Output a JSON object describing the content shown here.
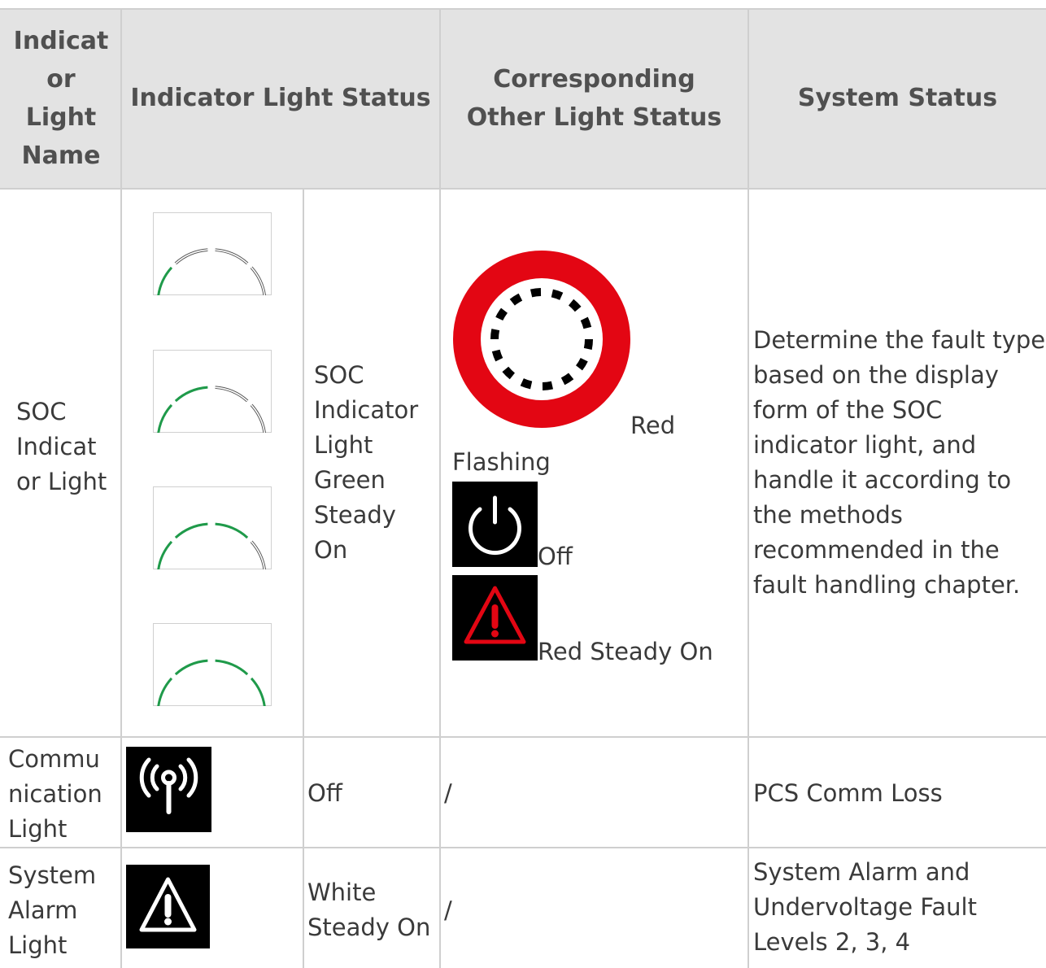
{
  "header": {
    "col1": "Indicat or Light Name",
    "col2": "Indicator Light Status",
    "col3": "Corresponding Other Light Status",
    "col4": "System Status"
  },
  "rows": [
    {
      "name": "SOC Indicat or Light",
      "status_text": "SOC Indicator Light Green Steady On",
      "soc_levels_lit": [
        1,
        2,
        3,
        4
      ],
      "other": {
        "red_flashing_label_a": "Red",
        "red_flashing_label_b": "Flashing",
        "off_label": "Off",
        "red_steady_label": "Red Steady On"
      },
      "system_status": "Determine the fault type based on the display form of the SOC indicator light, and handle it according to the methods recommended in the fault handling chapter."
    },
    {
      "name": "Commu nication Light",
      "status_text": "Off",
      "other": "/",
      "system_status": "PCS Comm Loss"
    },
    {
      "name": "System Alarm Light",
      "status_text": "White Steady On",
      "other": "/",
      "system_status": "System Alarm and Undervoltage Fault Levels 2, 3, 4"
    }
  ],
  "colors": {
    "header_bg": "#e3e3e3",
    "grid_line": "#cfcfcf",
    "soc_green": "#1f9a4a",
    "alarm_red": "#e30613",
    "icon_bg": "#000000"
  },
  "icons": [
    "soc-arc-icon",
    "red-ring-flashing-icon",
    "power-icon",
    "warning-triangle-icon",
    "wireless-signal-icon"
  ]
}
